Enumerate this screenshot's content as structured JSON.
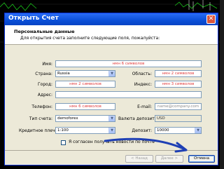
{
  "dialog": {
    "title": "Открыть Счет",
    "close_icon": "close-icon",
    "header_title": "Персональные данные",
    "header_sub": "Для открытия счета заполните следующие поля, пожалуйста:"
  },
  "form": {
    "name_label": "Имя:",
    "name_value": "нмн 6 символов",
    "country_label": "Страна:",
    "country_value": "Russia",
    "region_label": "Область:",
    "region_value": "нмн 2 символов",
    "city_label": "Город:",
    "city_value": "нмн 2 символов",
    "zip_label": "Индекс:",
    "zip_value": "нмн 3 символов",
    "address_label": "Адрес:",
    "address_value": "",
    "phone_label": "Телефон:",
    "phone_value": "нмн 6 символов",
    "email_label": "E-mail:",
    "email_value": "name@company.com",
    "account_type_label": "Тип счета:",
    "account_type_value": "demoforex",
    "currency_label": "Валюта депозита:",
    "currency_value": "USD",
    "leverage_label": "Кредитное плечо:",
    "leverage_value": "1:100",
    "deposit_label": "Депозит:",
    "deposit_value": "10000",
    "newsletter_label": "Я согласен получать новости по почте"
  },
  "buttons": {
    "back": "< Назад",
    "next": "Далее >",
    "cancel": "Отмена"
  },
  "colors": {
    "annotation_arrow": "#1e3fb4",
    "hint_text": "#e03a3a"
  }
}
